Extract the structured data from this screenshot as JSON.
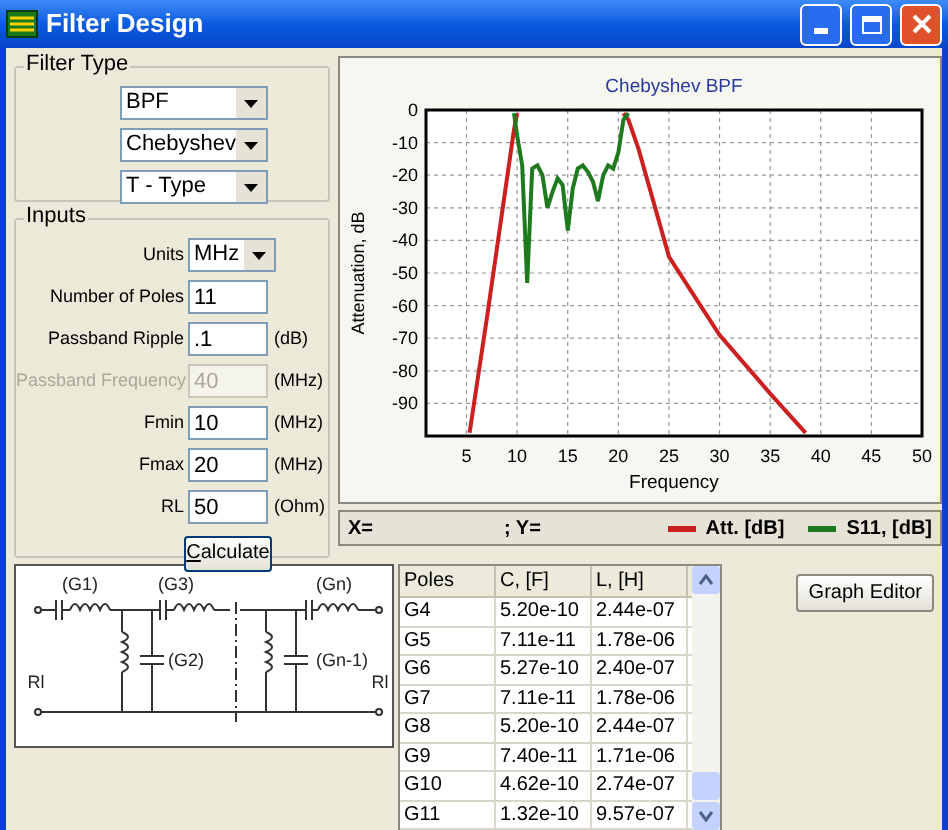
{
  "window": {
    "title": "Filter Design"
  },
  "filter_type": {
    "title": "Filter Type",
    "selects": [
      {
        "value": "BPF"
      },
      {
        "value": "Chebyshev"
      },
      {
        "value": "T - Type"
      }
    ]
  },
  "inputs": {
    "title": "Inputs",
    "rows": [
      {
        "kind": "select",
        "label": "Units",
        "value": "MHz",
        "disabled": false
      },
      {
        "kind": "field",
        "label": "Number of Poles",
        "value": "11",
        "disabled": false
      },
      {
        "kind": "field",
        "label": "Passband Ripple",
        "value": ".1",
        "unit": "(dB)",
        "disabled": false
      },
      {
        "kind": "field",
        "label": "Passband Frequency",
        "value": "40",
        "unit": "(MHz)",
        "disabled": true
      },
      {
        "kind": "field",
        "label": "Fmin",
        "value": "10",
        "unit": "(MHz)",
        "disabled": false
      },
      {
        "kind": "field",
        "label": "Fmax",
        "value": "20",
        "unit": "(MHz)",
        "disabled": false
      },
      {
        "kind": "field",
        "label": "RL",
        "value": "50",
        "unit": "(Ohm)",
        "disabled": false
      }
    ],
    "button": {
      "label": "Calculate"
    }
  },
  "chart": {
    "chart_data": {
      "type": "line",
      "title": "Chebyshev  BPF",
      "xlabel": "Frequency",
      "ylabel": "Attenuation, dB",
      "x": [
        5.3,
        7,
        9,
        9.7,
        10,
        10.5,
        11,
        11.5,
        12,
        12.5,
        13,
        13.5,
        14,
        14.5,
        15,
        15.5,
        16,
        16.5,
        17,
        17.5,
        18,
        18.5,
        19,
        19.5,
        20,
        20.5,
        21,
        22,
        25,
        30,
        35,
        38.5
      ],
      "series": [
        {
          "name": "Att. [dB]",
          "color": "#cc1f1f",
          "values": [
            -99,
            -64,
            -21,
            -6,
            -1,
            null,
            null,
            null,
            null,
            null,
            null,
            null,
            null,
            null,
            null,
            null,
            null,
            null,
            null,
            null,
            null,
            null,
            null,
            null,
            null,
            -1,
            -3,
            -12,
            -45,
            -69,
            -87,
            -99
          ]
        },
        {
          "name": "S11, [dB]",
          "color": "#1f7a1f",
          "values": [
            null,
            null,
            null,
            -1,
            -8,
            -17,
            -53,
            -18,
            -17,
            -20,
            -30,
            -25,
            -21,
            -23,
            -37,
            -24,
            -18,
            -17,
            -19,
            -22,
            -28,
            -20,
            -17,
            -18,
            -13,
            -3,
            -1,
            null,
            null,
            null,
            null,
            null
          ]
        }
      ],
      "grid": true,
      "xlim": [
        1,
        50
      ],
      "ylim": [
        -100,
        0
      ],
      "xticks": [
        5,
        10,
        15,
        20,
        25,
        30,
        35,
        40,
        45,
        50
      ],
      "yticks": [
        0,
        -10,
        -20,
        -30,
        -40,
        -50,
        -60,
        -70,
        -80,
        -90
      ]
    }
  },
  "readout": {
    "x_label": "X=",
    "y_label": "; Y="
  },
  "schematic": {
    "labels": [
      "(G1)",
      "(G3)",
      "(Gn)",
      "(G2)",
      "(Gn-1)",
      "Rl",
      "Rl"
    ]
  },
  "table": {
    "columns": [
      "Poles",
      "C, [F]",
      "L, [H]"
    ],
    "rows": [
      [
        "G4",
        "5.20e-10",
        "2.44e-07"
      ],
      [
        "G5",
        "7.11e-11",
        "1.78e-06"
      ],
      [
        "G6",
        "5.27e-10",
        "2.40e-07"
      ],
      [
        "G7",
        "7.11e-11",
        "1.78e-06"
      ],
      [
        "G8",
        "5.20e-10",
        "2.44e-07"
      ],
      [
        "G9",
        "7.40e-11",
        "1.71e-06"
      ],
      [
        "G10",
        "4.62e-10",
        "2.74e-07"
      ],
      [
        "G11",
        "1.32e-10",
        "9.57e-07"
      ]
    ]
  },
  "graph_editor_button": "Graph Editor"
}
